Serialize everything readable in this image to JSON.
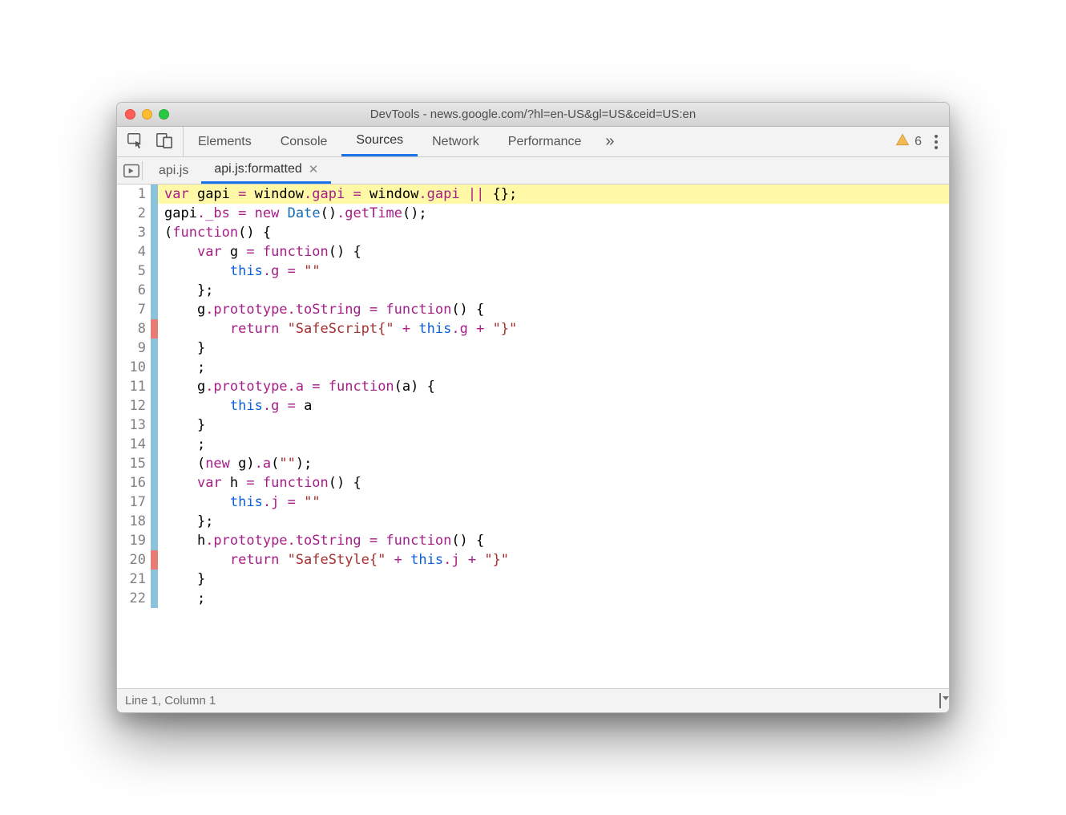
{
  "window": {
    "title": "DevTools - news.google.com/?hl=en-US&gl=US&ceid=US:en"
  },
  "tabs": {
    "main": [
      "Elements",
      "Console",
      "Sources",
      "Network",
      "Performance"
    ],
    "active": "Sources",
    "overflow": "»",
    "warn_count": "6"
  },
  "subtabs": {
    "items": [
      {
        "label": "api.js",
        "closeable": false
      },
      {
        "label": "api.js:formatted",
        "closeable": true
      }
    ],
    "active": 1
  },
  "code": {
    "lines": [
      {
        "n": 1,
        "mark": "blue",
        "hl": true,
        "tokens": [
          [
            "kw",
            "var"
          ],
          [
            "",
            " gapi "
          ],
          [
            "kw",
            "="
          ],
          [
            "",
            " window"
          ],
          [
            "prop",
            ".gapi"
          ],
          [
            "",
            " "
          ],
          [
            "kw",
            "="
          ],
          [
            "",
            " window"
          ],
          [
            "prop",
            ".gapi"
          ],
          [
            "",
            " "
          ],
          [
            "kw",
            "||"
          ],
          [
            "",
            " {};"
          ]
        ]
      },
      {
        "n": 2,
        "mark": "blue",
        "tokens": [
          [
            "",
            "gapi"
          ],
          [
            "prop",
            "._bs"
          ],
          [
            "",
            " "
          ],
          [
            "kw",
            "="
          ],
          [
            "",
            " "
          ],
          [
            "kw",
            "new"
          ],
          [
            "",
            " "
          ],
          [
            "def",
            "Date"
          ],
          [
            "",
            "()"
          ],
          [
            "prop",
            ".getTime"
          ],
          [
            "",
            "();"
          ]
        ]
      },
      {
        "n": 3,
        "mark": "blue",
        "tokens": [
          [
            "",
            "("
          ],
          [
            "kw",
            "function"
          ],
          [
            "",
            "() {"
          ]
        ]
      },
      {
        "n": 4,
        "mark": "blue",
        "tokens": [
          [
            "",
            "    "
          ],
          [
            "kw",
            "var"
          ],
          [
            "",
            " g "
          ],
          [
            "kw",
            "="
          ],
          [
            "",
            " "
          ],
          [
            "kw",
            "function"
          ],
          [
            "",
            "() {"
          ]
        ]
      },
      {
        "n": 5,
        "mark": "blue",
        "tokens": [
          [
            "",
            "        "
          ],
          [
            "this",
            "this"
          ],
          [
            "prop",
            ".g"
          ],
          [
            "",
            " "
          ],
          [
            "kw",
            "="
          ],
          [
            "",
            " "
          ],
          [
            "str",
            "\"\""
          ]
        ]
      },
      {
        "n": 6,
        "mark": "blue",
        "tokens": [
          [
            "",
            "    };"
          ]
        ]
      },
      {
        "n": 7,
        "mark": "blue",
        "tokens": [
          [
            "",
            "    g"
          ],
          [
            "prop",
            ".prototype"
          ],
          [
            "prop",
            ".toString"
          ],
          [
            "",
            " "
          ],
          [
            "kw",
            "="
          ],
          [
            "",
            " "
          ],
          [
            "kw",
            "function"
          ],
          [
            "",
            "() {"
          ]
        ]
      },
      {
        "n": 8,
        "mark": "red",
        "tokens": [
          [
            "",
            "        "
          ],
          [
            "kw",
            "return"
          ],
          [
            "",
            " "
          ],
          [
            "str",
            "\"SafeScript{\""
          ],
          [
            "",
            " "
          ],
          [
            "kw",
            "+"
          ],
          [
            "",
            " "
          ],
          [
            "this",
            "this"
          ],
          [
            "prop",
            ".g"
          ],
          [
            "",
            " "
          ],
          [
            "kw",
            "+"
          ],
          [
            "",
            " "
          ],
          [
            "str",
            "\"}\""
          ]
        ]
      },
      {
        "n": 9,
        "mark": "blue",
        "tokens": [
          [
            "",
            "    }"
          ]
        ]
      },
      {
        "n": 10,
        "mark": "blue",
        "tokens": [
          [
            "",
            "    ;"
          ]
        ]
      },
      {
        "n": 11,
        "mark": "blue",
        "tokens": [
          [
            "",
            "    g"
          ],
          [
            "prop",
            ".prototype"
          ],
          [
            "prop",
            ".a"
          ],
          [
            "",
            " "
          ],
          [
            "kw",
            "="
          ],
          [
            "",
            " "
          ],
          [
            "kw",
            "function"
          ],
          [
            "",
            "(a) {"
          ]
        ]
      },
      {
        "n": 12,
        "mark": "blue",
        "tokens": [
          [
            "",
            "        "
          ],
          [
            "this",
            "this"
          ],
          [
            "prop",
            ".g"
          ],
          [
            "",
            " "
          ],
          [
            "kw",
            "="
          ],
          [
            "",
            " a"
          ]
        ]
      },
      {
        "n": 13,
        "mark": "blue",
        "tokens": [
          [
            "",
            "    }"
          ]
        ]
      },
      {
        "n": 14,
        "mark": "blue",
        "tokens": [
          [
            "",
            "    ;"
          ]
        ]
      },
      {
        "n": 15,
        "mark": "blue",
        "tokens": [
          [
            "",
            "    ("
          ],
          [
            "kw",
            "new"
          ],
          [
            "",
            " g)"
          ],
          [
            "prop",
            ".a"
          ],
          [
            "",
            "("
          ],
          [
            "str",
            "\"\""
          ],
          [
            "",
            ");"
          ]
        ]
      },
      {
        "n": 16,
        "mark": "blue",
        "tokens": [
          [
            "",
            "    "
          ],
          [
            "kw",
            "var"
          ],
          [
            "",
            " h "
          ],
          [
            "kw",
            "="
          ],
          [
            "",
            " "
          ],
          [
            "kw",
            "function"
          ],
          [
            "",
            "() {"
          ]
        ]
      },
      {
        "n": 17,
        "mark": "blue",
        "tokens": [
          [
            "",
            "        "
          ],
          [
            "this",
            "this"
          ],
          [
            "prop",
            ".j"
          ],
          [
            "",
            " "
          ],
          [
            "kw",
            "="
          ],
          [
            "",
            " "
          ],
          [
            "str",
            "\"\""
          ]
        ]
      },
      {
        "n": 18,
        "mark": "blue",
        "tokens": [
          [
            "",
            "    };"
          ]
        ]
      },
      {
        "n": 19,
        "mark": "blue",
        "tokens": [
          [
            "",
            "    h"
          ],
          [
            "prop",
            ".prototype"
          ],
          [
            "prop",
            ".toString"
          ],
          [
            "",
            " "
          ],
          [
            "kw",
            "="
          ],
          [
            "",
            " "
          ],
          [
            "kw",
            "function"
          ],
          [
            "",
            "() {"
          ]
        ]
      },
      {
        "n": 20,
        "mark": "red",
        "tokens": [
          [
            "",
            "        "
          ],
          [
            "kw",
            "return"
          ],
          [
            "",
            " "
          ],
          [
            "str",
            "\"SafeStyle{\""
          ],
          [
            "",
            " "
          ],
          [
            "kw",
            "+"
          ],
          [
            "",
            " "
          ],
          [
            "this",
            "this"
          ],
          [
            "prop",
            ".j"
          ],
          [
            "",
            " "
          ],
          [
            "kw",
            "+"
          ],
          [
            "",
            " "
          ],
          [
            "str",
            "\"}\""
          ]
        ]
      },
      {
        "n": 21,
        "mark": "blue",
        "tokens": [
          [
            "",
            "    }"
          ]
        ]
      },
      {
        "n": 22,
        "mark": "blue",
        "tokens": [
          [
            "",
            "    ;"
          ]
        ]
      }
    ]
  },
  "status": {
    "text": "Line 1, Column 1"
  }
}
